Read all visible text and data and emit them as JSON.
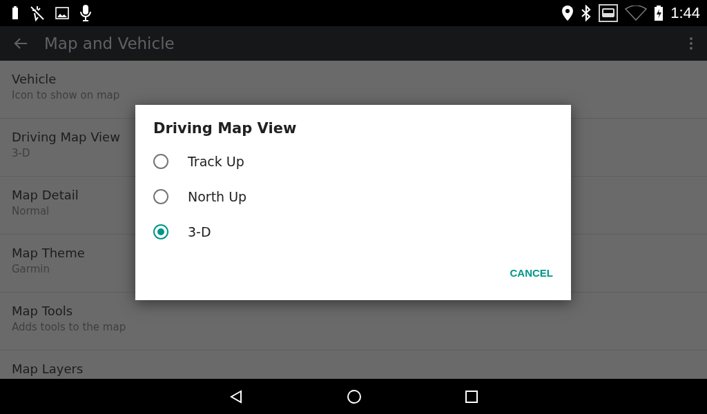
{
  "status_bar": {
    "time": "1:44"
  },
  "toolbar": {
    "title": "Map and Vehicle"
  },
  "settings": [
    {
      "title": "Vehicle",
      "summary": "Icon to show on map"
    },
    {
      "title": "Driving Map View",
      "summary": "3-D"
    },
    {
      "title": "Map Detail",
      "summary": "Normal"
    },
    {
      "title": "Map Theme",
      "summary": "Garmin"
    },
    {
      "title": "Map Tools",
      "summary": "Adds tools to the map"
    },
    {
      "title": "Map Layers"
    }
  ],
  "dialog": {
    "title": "Driving Map View",
    "options": [
      {
        "label": "Track Up",
        "selected": false
      },
      {
        "label": "North Up",
        "selected": false
      },
      {
        "label": "3-D",
        "selected": true
      }
    ],
    "button": "CANCEL"
  }
}
